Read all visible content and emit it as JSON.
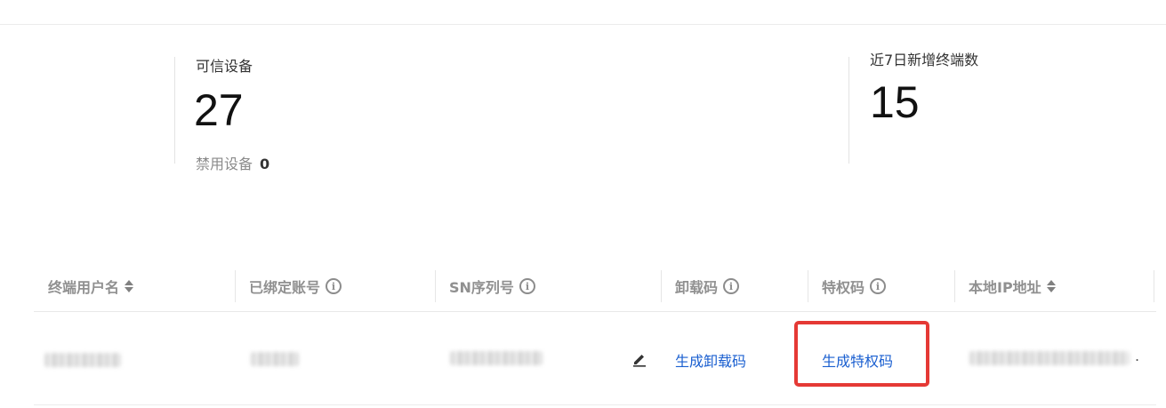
{
  "stats": {
    "trusted": {
      "label": "可信设备",
      "value": "27",
      "sub_label": "禁用设备",
      "sub_value": "0"
    },
    "new_terminals": {
      "label": "近7日新增终端数",
      "value": "15"
    }
  },
  "table": {
    "columns": [
      {
        "label": "终端用户名",
        "icon": "sort-icon"
      },
      {
        "label": "已绑定账号",
        "icon": "info-icon"
      },
      {
        "label": "SN序列号",
        "icon": "info-icon"
      },
      {
        "label": "卸载码",
        "icon": "info-icon"
      },
      {
        "label": "特权码",
        "icon": "info-icon"
      },
      {
        "label": "本地IP地址",
        "icon": "sort-icon"
      }
    ],
    "rows": [
      {
        "username": "",
        "bound_account": "",
        "sn": "",
        "uninstall_code_action": "生成卸载码",
        "privilege_code_action": "生成特权码",
        "local_ip": "",
        "trailing": "."
      }
    ]
  },
  "info_glyph": "i"
}
